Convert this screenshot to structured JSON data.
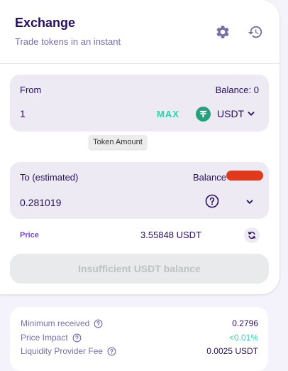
{
  "header": {
    "title": "Exchange",
    "subtitle": "Trade tokens in an instant",
    "settings_icon": "gear-icon",
    "history_icon": "history-icon"
  },
  "from": {
    "label": "From",
    "balance": "Balance: 0",
    "amount": "1",
    "max_label": "MAX",
    "token": "USDT"
  },
  "tooltip": "Token Amount",
  "to": {
    "label": "To (estimated)",
    "balance_label": "Balance",
    "amount": "0.281019"
  },
  "price": {
    "label": "Price",
    "value": "3.55848 USDT"
  },
  "action_button": "Insufficient USDT balance",
  "details": {
    "min_received_label": "Minimum received",
    "min_received_value": "0.2796",
    "price_impact_label": "Price Impact",
    "price_impact_value": "<0.01%",
    "lp_fee_label": "Liquidity Provider Fee",
    "lp_fee_value": "0.0025 USDT"
  },
  "colors": {
    "primary_text": "#280d5f",
    "secondary_text": "#7a6eaa",
    "accent_teal": "#31d0aa",
    "accent_purple": "#7645d9",
    "panel_bg": "#eeeaf4",
    "usdt_green": "#26a17b"
  }
}
